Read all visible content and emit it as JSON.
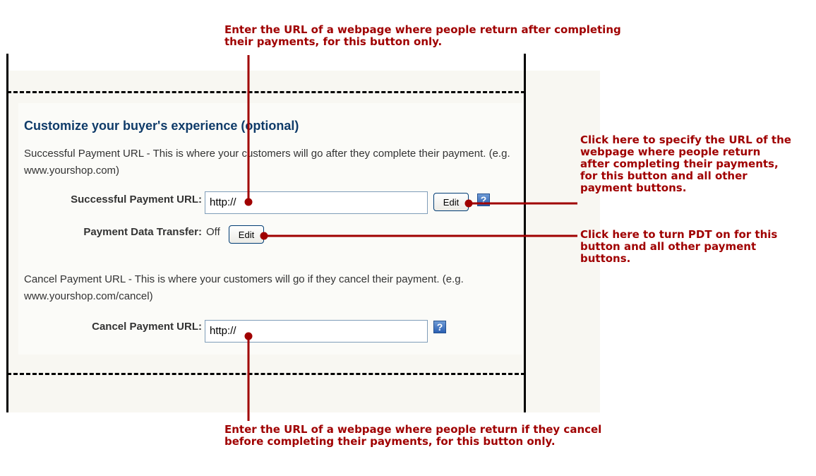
{
  "form": {
    "heading": "Customize your buyer's experience (optional)",
    "success_desc": "Successful Payment URL - This is where your customers will go after they complete their payment. (e.g. www.yourshop.com)",
    "success_label": "Successful Payment URL:",
    "success_value": "http://",
    "edit_label": "Edit",
    "help_glyph": "?",
    "pdt_label": "Payment Data Transfer:",
    "pdt_value": "Off",
    "cancel_desc": "Cancel Payment URL - This is where your customers will go if they cancel their payment. (e.g. www.yourshop.com/cancel)",
    "cancel_label": "Cancel Payment URL:",
    "cancel_value": "http://"
  },
  "annotations": {
    "top": "Enter the URL of a webpage where people return after completing their payments, for this button only.",
    "edit_url": "Click here to specify the URL of the webpage where people return after completing their payments, for this button and all other payment buttons.",
    "edit_pdt": "Click here to turn PDT on for this button and all other payment buttons.",
    "bottom": "Enter the URL of a webpage where people return if they cancel before completing their payments, for this button only."
  },
  "colors": {
    "annotation": "#a00000",
    "heading": "#0f3b69",
    "help_icon": "#2a5fb2"
  },
  "icons": [
    "help-icon",
    "help-icon"
  ]
}
